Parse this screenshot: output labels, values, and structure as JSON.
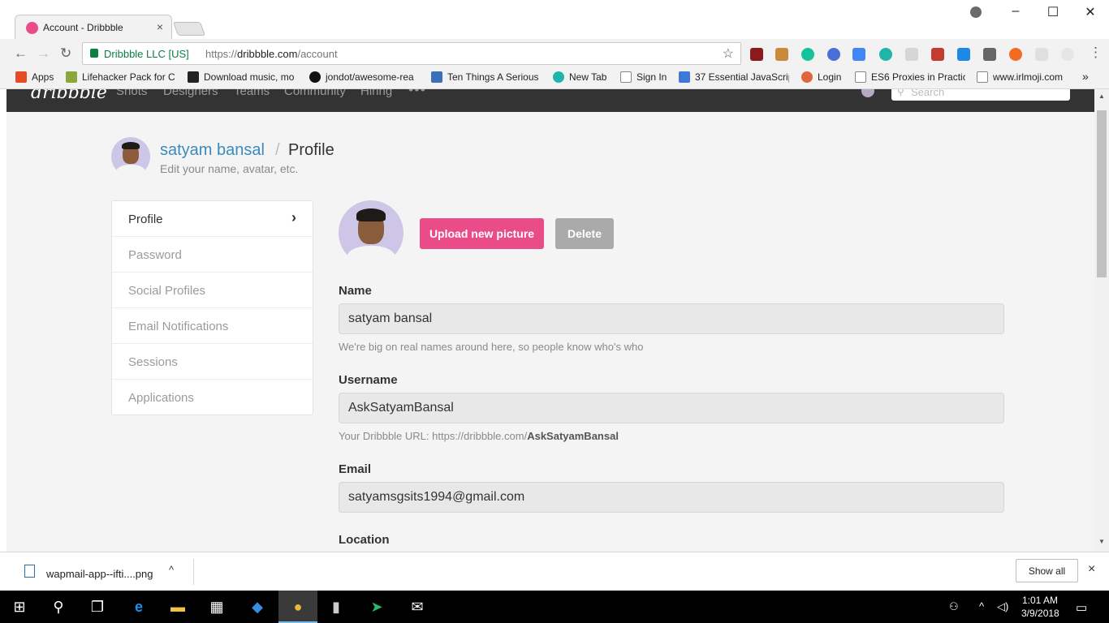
{
  "browser": {
    "tab_title": "Account - Dribbble",
    "tab_close": "×",
    "address_ev": "Dribbble LLC [US]",
    "url_scheme": "https://",
    "url_host": "dribbble.com",
    "url_path": "/account",
    "bookmarks": [
      {
        "label": "Apps",
        "icon": "apps-grid-icon"
      },
      {
        "label": "Lifehacker Pack for Cl",
        "icon": "lifehacker-icon"
      },
      {
        "label": "Download music, mo",
        "icon": "download-icon"
      },
      {
        "label": "jondot/awesome-rea",
        "icon": "github-icon"
      },
      {
        "label": "Ten Things A Serious",
        "icon": "code-icon"
      },
      {
        "label": "New Tab",
        "icon": "m-icon"
      },
      {
        "label": "Sign In",
        "icon": "page-icon"
      },
      {
        "label": "37 Essential JavaScrip",
        "icon": "k-icon"
      },
      {
        "label": "Login",
        "icon": "login-icon"
      },
      {
        "label": "ES6 Proxies in Practic",
        "icon": "page-icon"
      },
      {
        "label": "www.irlmoji.com",
        "icon": "page-icon"
      }
    ],
    "bookmarks_overflow": "»"
  },
  "site_nav": {
    "logo": "dribbble",
    "items": [
      "Shots",
      "Designers",
      "Teams",
      "Community",
      "Hiring"
    ],
    "more": "•••",
    "search_placeholder": "Search"
  },
  "header": {
    "user_name": "satyam bansal",
    "separator": "/",
    "title": "Profile",
    "subtitle": "Edit your name, avatar, etc."
  },
  "sidebar": {
    "items": [
      {
        "label": "Profile",
        "active": true
      },
      {
        "label": "Password",
        "active": false
      },
      {
        "label": "Social Profiles",
        "active": false
      },
      {
        "label": "Email Notifications",
        "active": false
      },
      {
        "label": "Sessions",
        "active": false
      },
      {
        "label": "Applications",
        "active": false
      }
    ],
    "chevron": "›"
  },
  "profile_form": {
    "upload_label": "Upload new picture",
    "delete_label": "Delete",
    "name": {
      "label": "Name",
      "value": "satyam bansal",
      "hint": "We're big on real names around here, so people know who's who"
    },
    "username": {
      "label": "Username",
      "value": "AskSatyamBansal",
      "hint_prefix": "Your Dribbble URL: https://dribbble.com/",
      "hint_bold": "AskSatyamBansal"
    },
    "email": {
      "label": "Email",
      "value": "satyamsgsits1994@gmail.com"
    },
    "location": {
      "label": "Location"
    }
  },
  "download_shelf": {
    "file_name": "wapmail-app--ifti....png",
    "caret": "^",
    "show_all": "Show all",
    "close": "×"
  },
  "taskbar": {
    "time": "1:01 AM",
    "date": "3/9/2018"
  },
  "colors": {
    "brand_pink": "#ea4c89",
    "link_blue": "#3a8bbb",
    "nav_dark": "#333333"
  }
}
